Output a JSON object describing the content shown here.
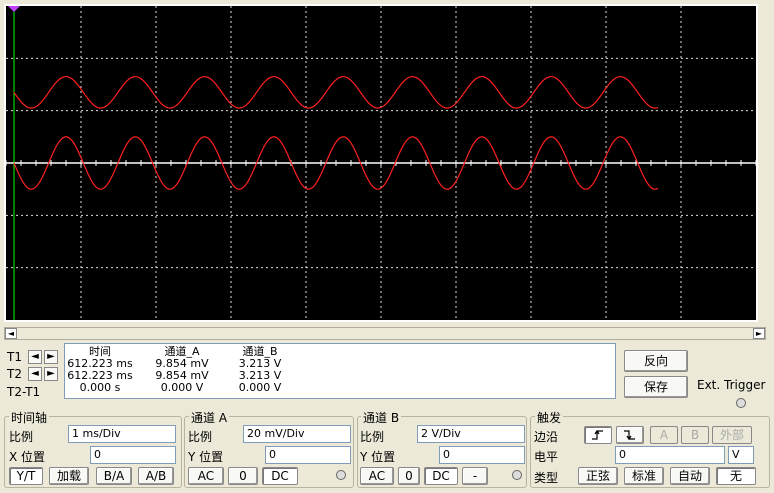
{
  "scope": {
    "colors": {
      "background": "#000000",
      "grid": "#dddddd",
      "axis": "#ffffff",
      "trace": "#ff2020",
      "cursor": "#00ff00",
      "marker": "#c040ff"
    },
    "trace_a": {
      "periods": 9.3,
      "offset_divs": 1.35,
      "amplitude_divs": 0.3
    },
    "trace_b": {
      "periods": 9.3,
      "offset_divs": 0,
      "amplitude_divs": 0.5
    }
  },
  "readout": {
    "headers": {
      "time": "时间",
      "ch_a": "通道_A",
      "ch_b": "通道_B"
    },
    "rows": [
      {
        "label": "T1",
        "time": "612.223 ms",
        "ch_a": "9.854 mV",
        "ch_b": "3.213 V"
      },
      {
        "label": "T2",
        "time": "612.223 ms",
        "ch_a": "9.854 mV",
        "ch_b": "3.213 V"
      },
      {
        "label": "T2-T1",
        "time": "0.000 s",
        "ch_a": "0.000 V",
        "ch_b": "0.000 V"
      }
    ]
  },
  "right_panel": {
    "reverse": "反向",
    "save": "保存",
    "ext_trigger": "Ext. Trigger"
  },
  "timebase": {
    "title": "时间轴",
    "scale_label": "比例",
    "scale": "1 ms/Div",
    "xpos_label": "X 位置",
    "xpos": "0",
    "buttons": [
      "Y/T",
      "加载",
      "B/A",
      "A/B"
    ]
  },
  "channel_a": {
    "title": "通道 A",
    "scale_label": "比例",
    "scale": "20 mV/Div",
    "ypos_label": "Y 位置",
    "ypos": "0",
    "buttons": [
      "AC",
      "0",
      "DC"
    ]
  },
  "channel_b": {
    "title": "通道 B",
    "scale_label": "比例",
    "scale": "2  V/Div",
    "ypos_label": "Y 位置",
    "ypos": "0",
    "buttons": [
      "AC",
      "0",
      "DC",
      "-"
    ]
  },
  "trigger": {
    "title": "触发",
    "edge_label": "边沿",
    "level_label": "电平",
    "level": "0",
    "level_unit": "V",
    "type_label": "类型",
    "edge_buttons": [
      "A",
      "B",
      "外部"
    ],
    "type_buttons": [
      "正弦",
      "标准",
      "自动",
      "无"
    ]
  },
  "scroll": {
    "left": "◄",
    "right": "►"
  }
}
